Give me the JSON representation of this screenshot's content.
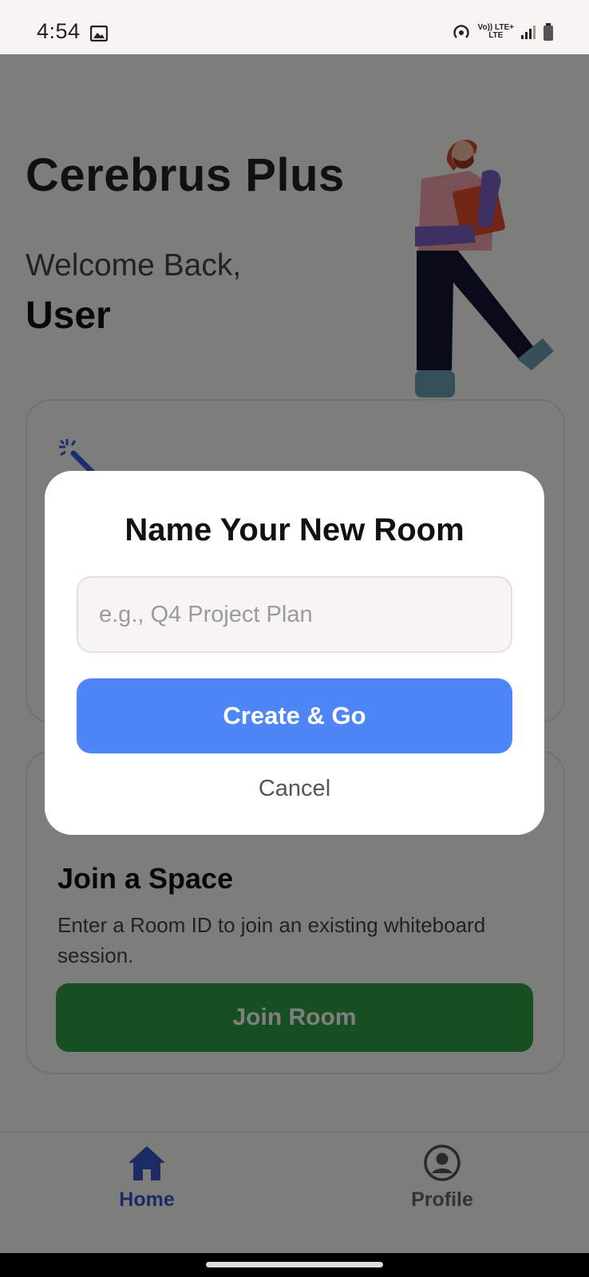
{
  "status_bar": {
    "time": "4:54",
    "network_top": "Vo)) LTE+",
    "network_bottom": "LTE",
    "icons": [
      "image-icon",
      "hotspot-icon",
      "signal-icon",
      "battery-icon"
    ]
  },
  "home": {
    "app_title": "Cerebrus Plus",
    "welcome": "Welcome Back,",
    "username": "User",
    "join_card": {
      "title": "Join a Space",
      "description": "Enter a Room ID to join an existing whiteboard session.",
      "button": "Join Room"
    }
  },
  "dialog": {
    "title": "Name Your New Room",
    "input_value": "",
    "input_placeholder": "e.g., Q4 Project Plan",
    "create_button": "Create & Go",
    "cancel_button": "Cancel"
  },
  "nav": {
    "items": [
      {
        "label": "Home",
        "icon": "home-icon",
        "active": true
      },
      {
        "label": "Profile",
        "icon": "profile-icon",
        "active": false
      }
    ]
  },
  "colors": {
    "primary_blue": "#4f86f7",
    "join_green": "#2f9e44",
    "nav_active": "#3759c9",
    "scrim": "rgba(0,0,0,0.5)"
  }
}
